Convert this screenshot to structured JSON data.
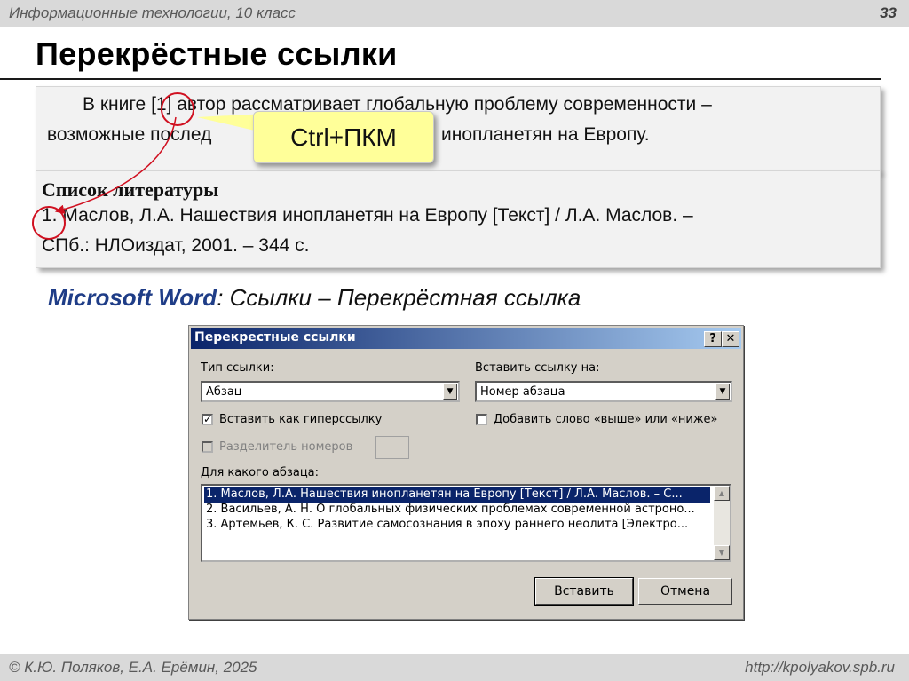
{
  "header": {
    "course": "Информационные технологии, 10 класс",
    "slide_number": "33"
  },
  "slide_title": "Перекрёстные ссылки",
  "text_box": {
    "line1": "В книге [1] автор рассматривает глобальную проблему современности –",
    "line2_start": "возможные послед",
    "line2_end": "инопланетян на Европу."
  },
  "callout": "Ctrl+ПКМ",
  "bibliography": {
    "heading": "Список литературы",
    "line1": "1. Маслов, Л.А. Нашествия инопланетян на Европу [Текст] / Л.А. Маслов. –",
    "line2": "СПб.: НЛОиздат, 2001. –  344 с."
  },
  "caption": {
    "app": "Microsoft Word",
    "colon": ":",
    "path": "Ссылки – Перекрёстная ссылка"
  },
  "dialog": {
    "title": "Перекрестные ссылки",
    "help_button": "?",
    "close_button": "✕",
    "ref_type_label": "Тип ссылки:",
    "ref_type_value": "Абзац",
    "insert_ref_label": "Вставить ссылку на:",
    "insert_ref_value": "Номер абзаца",
    "hyperlink_checkbox": "Вставить как гиперссылку",
    "above_below_checkbox": "Добавить слово «выше» или «ниже»",
    "separator_checkbox": "Разделитель номеров",
    "which_paragraph_label": "Для какого абзаца:",
    "paragraphs": [
      "1. Маслов, Л.А. Нашествия инопланетян на Европу [Текст] / Л.А. Маслов. – С...",
      "2. Васильев, А. Н. О глобальных физических проблемах современной астроно...",
      "3. Артемьев, К. С. Развитие самосознания в эпоху раннего неолита [Электро..."
    ],
    "insert_button": "Вставить",
    "cancel_button": "Отмена"
  },
  "footer": {
    "authors": "© К.Ю. Поляков, Е.А. Ерёмин, 2025",
    "site": "http://kpolyakov.spb.ru"
  },
  "colors": {
    "accent_red": "#d01020",
    "callout_yellow": "#ffff99",
    "caption_blue": "#1f3d87",
    "titlebar_blue": "#0a246a"
  }
}
